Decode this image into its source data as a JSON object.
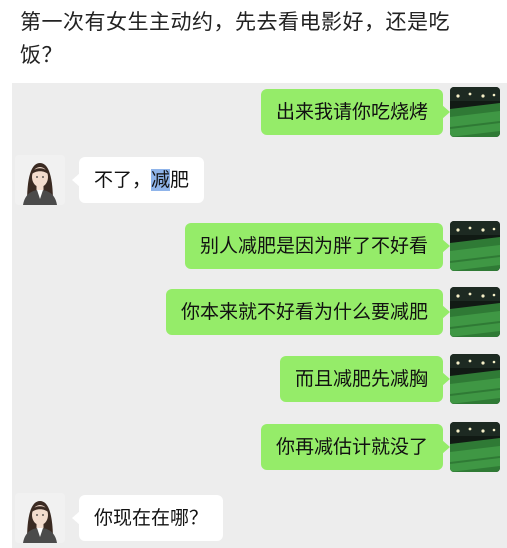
{
  "post": {
    "title": "第一次有女生主动约，先去看电影好，还是吃饭？"
  },
  "chat": {
    "messages": [
      {
        "from": "me",
        "text": "出来我请你吃烧烤"
      },
      {
        "from": "her",
        "text_before": "不了，",
        "text_highlight": "减",
        "text_after": "肥"
      },
      {
        "from": "me",
        "text": "别人减肥是因为胖了不好看"
      },
      {
        "from": "me",
        "text": "你本来就不好看为什么要减肥"
      },
      {
        "from": "me",
        "text": "而且减肥先减胸"
      },
      {
        "from": "me",
        "text": "你再减估计就没了"
      },
      {
        "from": "her",
        "text": "你现在在哪？"
      }
    ],
    "colors": {
      "outgoing_bubble": "#95ec69",
      "incoming_bubble": "#ffffff",
      "chat_background": "#ededed",
      "selection_highlight": "#8fb4ea"
    },
    "icons": {
      "me_avatar": "stadium-photo-avatar-icon",
      "her_avatar": "girl-portrait-avatar-icon"
    }
  }
}
